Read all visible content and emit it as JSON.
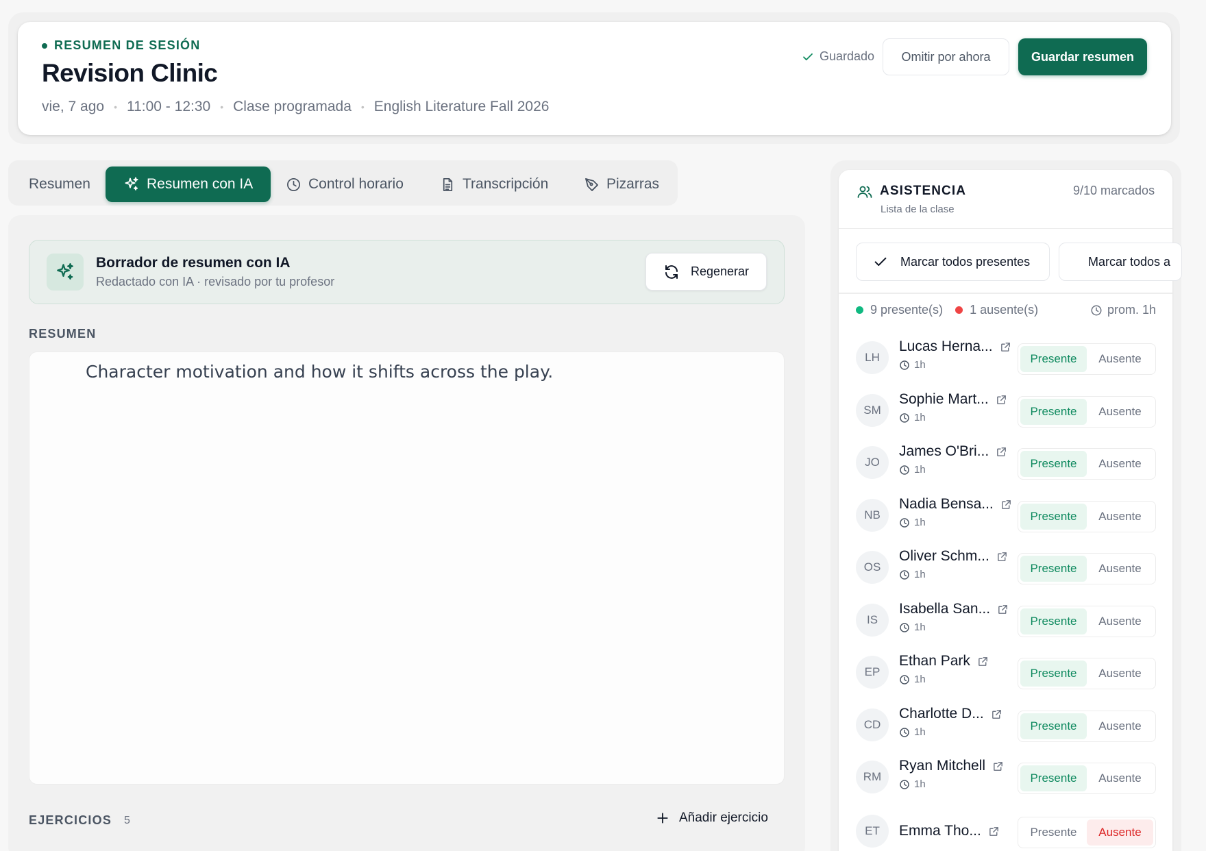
{
  "header": {
    "eyebrow": "RESUMEN DE SESIÓN",
    "title": "Revision Clinic",
    "meta": [
      "vie, 7 ago",
      "11:00 - 12:30",
      "Clase programada",
      "English Literature Fall 2026"
    ],
    "saved_label": "Guardado",
    "skip_label": "Omitir por ahora",
    "save_label": "Guardar resumen"
  },
  "tabs": [
    {
      "label": "Resumen",
      "icon": "none",
      "active": false
    },
    {
      "label": "Resumen con IA",
      "icon": "sparkles-icon",
      "active": true
    },
    {
      "label": "Control horario",
      "icon": "clock-icon",
      "active": false
    },
    {
      "label": "Transcripción",
      "icon": "document-icon",
      "active": false
    },
    {
      "label": "Pizarras",
      "icon": "pen-tool-icon",
      "active": false
    }
  ],
  "ai_banner": {
    "title": "Borrador de resumen con IA",
    "subtitle": "Redactado con IA · revisado por tu profesor",
    "regen_label": "Regenerar"
  },
  "summary": {
    "label": "RESUMEN",
    "text": "Character motivation and how it shifts across the play."
  },
  "exercises": {
    "label": "EJERCICIOS",
    "count": "5",
    "add_label": "Añadir ejercicio"
  },
  "attendance": {
    "title": "ASISTENCIA",
    "subtitle": "Lista de la clase",
    "count": "9/10 marcados",
    "mark_all_present": "Marcar todos presentes",
    "mark_all_absent": "Marcar todos a",
    "present_count": "9 presente(s)",
    "absent_count": "1 ausente(s)",
    "average": "prom. 1h",
    "present_label": "Presente",
    "absent_label": "Ausente",
    "colors": {
      "accent": "#0f6b52",
      "present": "#10b981",
      "absent": "#ef4444"
    },
    "students": [
      {
        "initials": "LH",
        "name": "Lucas Herna...",
        "duration": "1h",
        "status": "present"
      },
      {
        "initials": "SM",
        "name": "Sophie Mart...",
        "duration": "1h",
        "status": "present"
      },
      {
        "initials": "JO",
        "name": "James O'Bri...",
        "duration": "1h",
        "status": "present"
      },
      {
        "initials": "NB",
        "name": "Nadia Bensa...",
        "duration": "1h",
        "status": "present"
      },
      {
        "initials": "OS",
        "name": "Oliver Schm...",
        "duration": "1h",
        "status": "present"
      },
      {
        "initials": "IS",
        "name": "Isabella San...",
        "duration": "1h",
        "status": "present"
      },
      {
        "initials": "EP",
        "name": "Ethan Park",
        "duration": "1h",
        "status": "present"
      },
      {
        "initials": "CD",
        "name": "Charlotte D...",
        "duration": "1h",
        "status": "present"
      },
      {
        "initials": "RM",
        "name": "Ryan Mitchell",
        "duration": "1h",
        "status": "present"
      },
      {
        "initials": "ET",
        "name": "Emma Tho...",
        "duration": "",
        "status": "absent"
      }
    ]
  }
}
